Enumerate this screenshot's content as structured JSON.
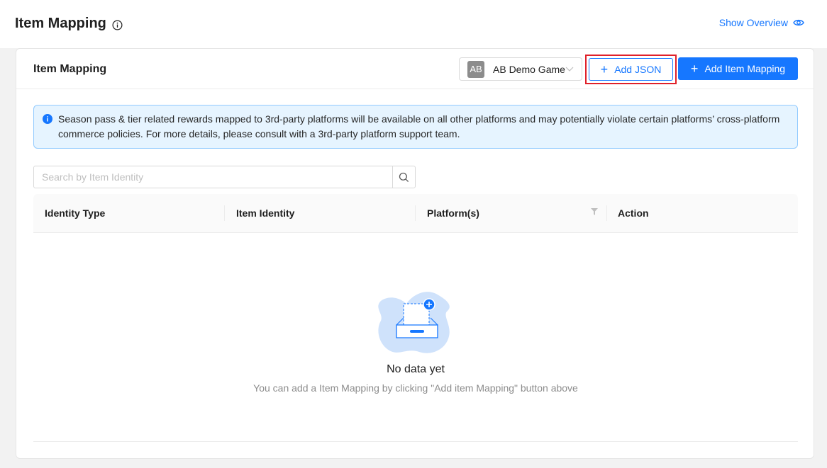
{
  "header": {
    "title": "Item Mapping",
    "show_overview_label": "Show Overview"
  },
  "card": {
    "title": "Item Mapping",
    "game_select": {
      "avatar_text": "AB",
      "selected": "AB Demo Game"
    },
    "add_json_label": "Add JSON",
    "add_mapping_label": "Add Item Mapping"
  },
  "alert": {
    "text": "Season pass & tier related rewards mapped to 3rd-party platforms will be available on all other platforms and may potentially violate certain platforms’ cross-platform commerce policies. For more details, please consult with a 3rd-party platform support team."
  },
  "search": {
    "placeholder": "Search by Item Identity",
    "value": ""
  },
  "table": {
    "columns": [
      "Identity Type",
      "Item Identity",
      "Platform(s)",
      "Action"
    ],
    "rows": []
  },
  "empty_state": {
    "title": "No data yet",
    "description": "You can add a Item Mapping by clicking \"Add item Mapping\" button above"
  },
  "colors": {
    "primary": "#1677ff",
    "highlight": "#e0202a",
    "alert_bg": "#e6f4ff"
  }
}
